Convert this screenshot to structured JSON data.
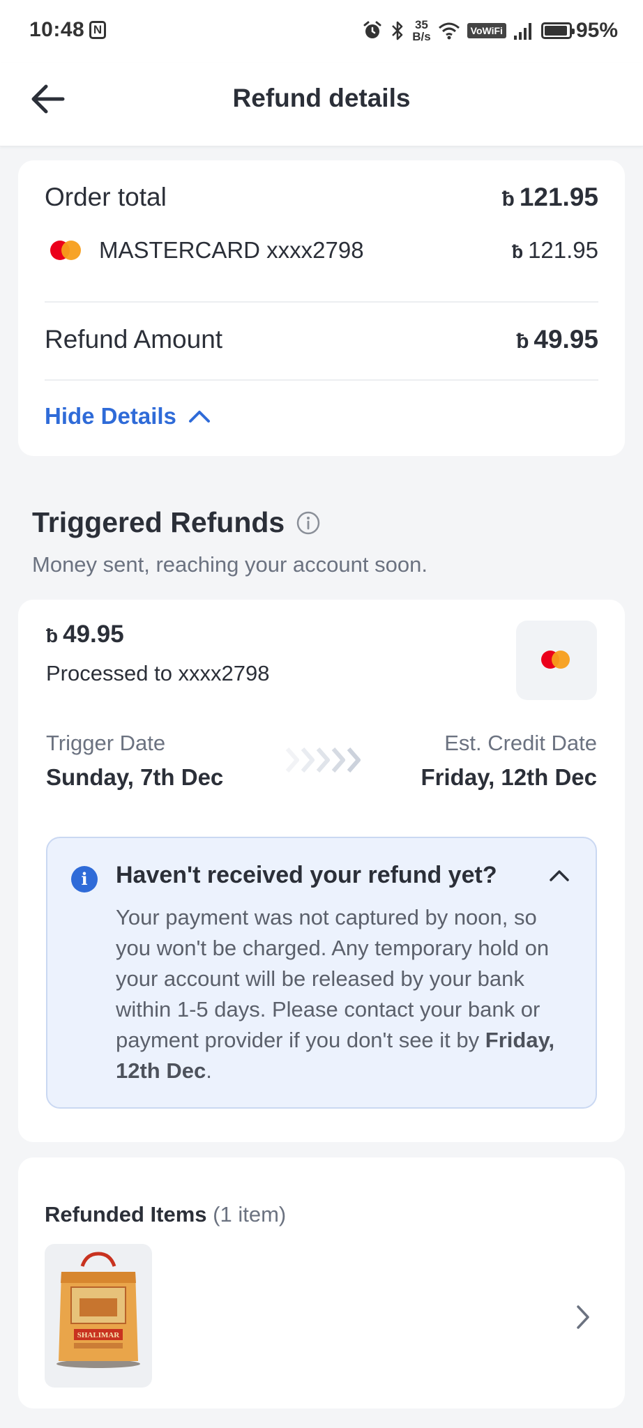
{
  "status_bar": {
    "time": "10:48",
    "notif_badge": "N",
    "speed_value": "35",
    "speed_unit": "B/s",
    "vowifi": "VoWiFi",
    "battery": "95%",
    "battery_level": 0.95
  },
  "header": {
    "title": "Refund details",
    "back_icon": "arrow-left-icon"
  },
  "summary": {
    "currency_symbol": "ƀ",
    "order_total_label": "Order total",
    "order_total_value": "121.95",
    "card_label": "MASTERCARD xxxx2798",
    "card_value": "121.95",
    "refund_label": "Refund Amount",
    "refund_value": "49.95",
    "toggle_label": "Hide Details"
  },
  "triggered": {
    "title": "Triggered Refunds",
    "subtitle": "Money sent, reaching your account soon.",
    "amount": "49.95",
    "processed_to": "Processed to xxxx2798",
    "trigger_date_label": "Trigger Date",
    "trigger_date_value": "Sunday, 7th Dec",
    "credit_date_label": "Est. Credit Date",
    "credit_date_value": "Friday, 12th Dec",
    "info": {
      "title": "Haven't received your refund yet?",
      "body": "Your payment was not captured by noon, so you won't be charged. Any temporary hold on your account will be released by your bank within 1-5 days. Please contact your bank or payment provider if you don't see it by",
      "body_bold": "Friday, 12th Dec",
      "body_end": "."
    }
  },
  "refunded_items": {
    "title": "Refunded Items",
    "count": "(1 item)",
    "product_brand": "SHALIMAR"
  },
  "colors": {
    "accent": "#2f6bd8",
    "mastercard_red": "#eb001b",
    "mastercard_orange": "#f79e1b",
    "info_bg": "#ecf2fd"
  }
}
